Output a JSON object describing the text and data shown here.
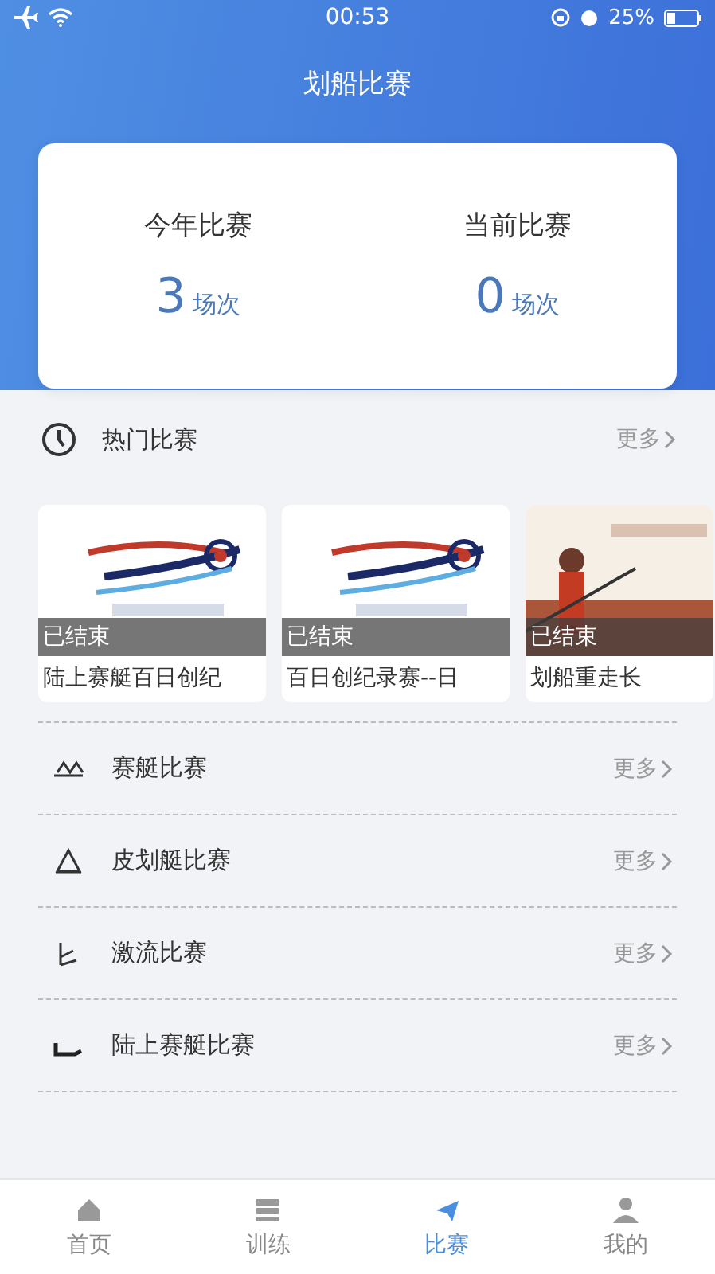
{
  "status_bar": {
    "time": "00:53",
    "battery": "25%"
  },
  "header": {
    "title": "划船比赛"
  },
  "summary": [
    {
      "label": "今年比赛",
      "count": "3",
      "unit": "场次"
    },
    {
      "label": "当前比赛",
      "count": "0",
      "unit": "场次"
    }
  ],
  "hot": {
    "title": "热门比赛",
    "more": "更多",
    "cards": [
      {
        "kind": "picture",
        "status": "已结束",
        "title": "陆上赛艇百日创纪"
      },
      {
        "kind": "picture",
        "status": "已结束",
        "title": "百日创纪录赛--日"
      },
      {
        "kind": "picture",
        "status": "已结束",
        "title": "划船重走长"
      }
    ]
  },
  "categories": [
    {
      "kind": "rowing",
      "label": "赛艇比赛",
      "more": "更多"
    },
    {
      "kind": "kayak",
      "label": "皮划艇比赛",
      "more": "更多"
    },
    {
      "kind": "rafting",
      "label": "激流比赛",
      "more": "更多"
    },
    {
      "kind": "ergometer",
      "label": "陆上赛艇比赛",
      "more": "更多"
    }
  ],
  "tabs": [
    {
      "kind": "home",
      "label": "首页",
      "selected": false
    },
    {
      "kind": "training",
      "label": "训练",
      "selected": false
    },
    {
      "kind": "race",
      "label": "比赛",
      "selected": true
    },
    {
      "kind": "me",
      "label": "我的",
      "selected": false
    }
  ]
}
